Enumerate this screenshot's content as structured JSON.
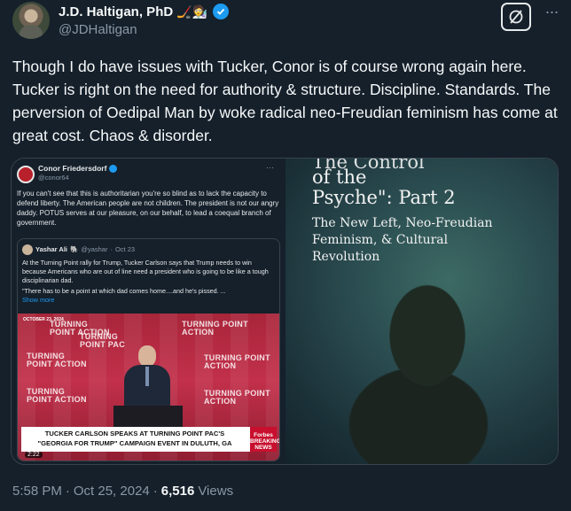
{
  "author": {
    "name": "J.D. Haltigan, PhD",
    "emoji": "🏒🧑‍🔬",
    "handle": "@JDHaltigan"
  },
  "tweet": {
    "text": "Though I do have issues with Tucker, Conor is of course wrong again here. Tucker is right on the need for authority & structure. Discipline. Standards. The perversion of Oedipal Man by woke radical neo-Freudian feminism has come at great cost. Chaos & disorder."
  },
  "icons": {
    "grok": "grok-icon",
    "more": "more-icon",
    "verified": "verified-badge-icon"
  },
  "quoted": {
    "name": "Conor Friedersdorf",
    "handle": "@conor64",
    "text": "If you can't see that this is authoritarian you're so blind as to lack the capacity to defend liberty. The American people are not children. The president is not our angry daddy. POTUS serves at our pleasure, on our behalf, to lead a coequal branch of government.",
    "inner": {
      "name": "Yashar Ali",
      "emoji": "🐘",
      "handle": "@yashar",
      "date": "Oct 23",
      "text": "At the Turning Point rally for Trump, Tucker Carlson says that Trump needs to win because Americans who are out of line need a president who is going to be like a tough disciplinarian dad.",
      "text2": "\"There has to be a point at which dad comes home....and he's pissed. ...",
      "show_more": "Show more",
      "video": {
        "banner": "TUCKER CARLSON SPEAKS AT TURNING POINT PAC'S \"GEORGIA FOR TRUMP\" CAMPAIGN EVENT IN DULUTH, GA",
        "brand": "Forbes",
        "brand_sub": "BREAKING NEWS",
        "dateline": "OCTOBER 23, 2024",
        "duration": "2:22",
        "logo_text": "TURNING POINT ACTION",
        "logo_text2": "TURNING POINT PAC"
      }
    }
  },
  "article_image": {
    "top_fragment": "The Control",
    "line1": "of the",
    "line2": "Psyche\": Part 2",
    "subtitle": "The New Left, Neo-Freudian Feminism, & Cultural Revolution"
  },
  "footer": {
    "time": "5:58 PM",
    "sep": "·",
    "date": "Oct 25, 2024",
    "views_count": "6,516",
    "views_label": "Views"
  }
}
